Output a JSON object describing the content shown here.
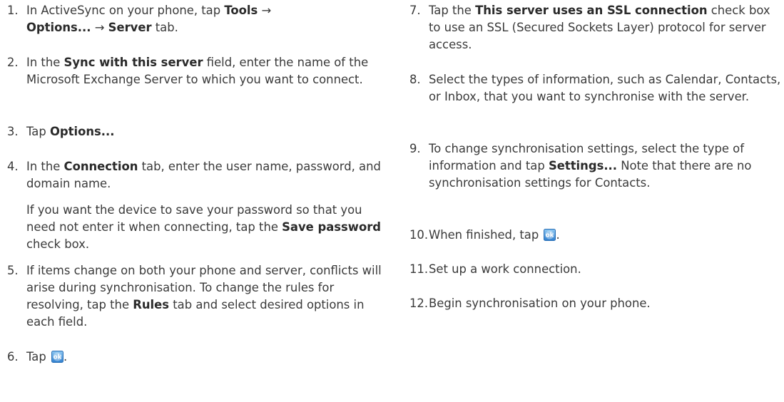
{
  "steps": [
    {
      "num": "1.",
      "parts": [
        "In ActiveSync on your phone, tap ",
        "Tools",
        " → ",
        "Options...",
        " → ",
        "Server",
        " tab."
      ]
    },
    {
      "num": "2.",
      "parts": [
        "In the ",
        "Sync with this server",
        " field, enter the name of the Microsoft Exchange Server to which you want to connect."
      ]
    },
    {
      "num": "3.",
      "parts": [
        "Tap ",
        "Options..."
      ]
    },
    {
      "num": "4.",
      "parts": [
        "In the ",
        "Connection",
        " tab, enter the user name, password, and domain name."
      ],
      "note": [
        "If you want the device to save your password so that you need not enter it when connecting, tap the ",
        "Save password",
        " check box."
      ]
    },
    {
      "num": "5.",
      "parts": [
        "If items change on both your phone and server, conflicts will arise during synchronisation. To change the rules for resolving, tap the ",
        "Rules",
        " tab and select desired options in each field."
      ]
    },
    {
      "num": "6.",
      "parts": [
        "Tap ",
        "."
      ]
    },
    {
      "num": "7.",
      "parts": [
        "Tap the ",
        "This server uses an SSL connection",
        " check box to use an SSL (Secured Sockets Layer) protocol for server access."
      ]
    },
    {
      "num": "8.",
      "parts": [
        "Select the types of information, such as Calendar, Contacts, or Inbox, that you want to synchronise with the server."
      ]
    },
    {
      "num": "9.",
      "parts": [
        "To change synchronisation settings, select the type of information and tap ",
        "Settings...",
        " Note that there are no synchronisation settings for Contacts."
      ]
    },
    {
      "num": "10.",
      "parts": [
        "When finished, tap ",
        "."
      ]
    },
    {
      "num": "11.",
      "parts": [
        "Set up a work connection."
      ]
    },
    {
      "num": "12.",
      "parts": [
        "Begin synchronisation on your phone."
      ]
    }
  ],
  "icons": {
    "ok": "ok-button-icon"
  },
  "colors": {
    "text": "#3a3a3a",
    "ok_icon_bg": "#3d8fd6"
  }
}
